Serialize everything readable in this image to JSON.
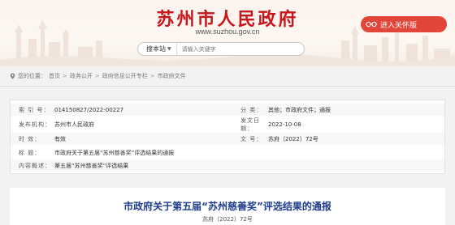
{
  "header": {
    "site_title": "苏州市人民政府",
    "site_url": "www.suzhou.gov.cn",
    "care_button": "进入关怀版",
    "search": {
      "station_label": "搜本站",
      "placeholder": "请输入关键字"
    }
  },
  "breadcrumb": {
    "label": "您的位置：",
    "items": [
      "首页",
      "政务公开",
      "政府信息公开专栏",
      "市政府文件"
    ]
  },
  "meta": {
    "index_label": "索 引 号：",
    "index_value": "014150827/2022-00227",
    "category_label": "分 类：",
    "category_value": "其他；市政府文件；通报",
    "publisher_label": "发布机构：",
    "publisher_value": "苏州市人民政府",
    "date_label": "发文日期：",
    "date_value": "2022-10-08",
    "validity_label": "时 效：",
    "validity_value": "有效",
    "docno_label": "文 号：",
    "docno_value": "苏府〔2022〕72号",
    "title_label": "标 题：",
    "title_value": "市政府关于第五届“苏州慈善奖”评选结果的通报",
    "summary_label": "内容概述：",
    "summary_value": "第五届“苏州慈善奖”评选结果"
  },
  "article": {
    "title": "市政府关于第五届“苏州慈善奖”评选结果的通报",
    "doc_number": "苏府〔2022〕72号"
  },
  "colors": {
    "brand_red": "#c8161d",
    "title_blue": "#1f3d8c",
    "care_button": "#e2453a"
  }
}
